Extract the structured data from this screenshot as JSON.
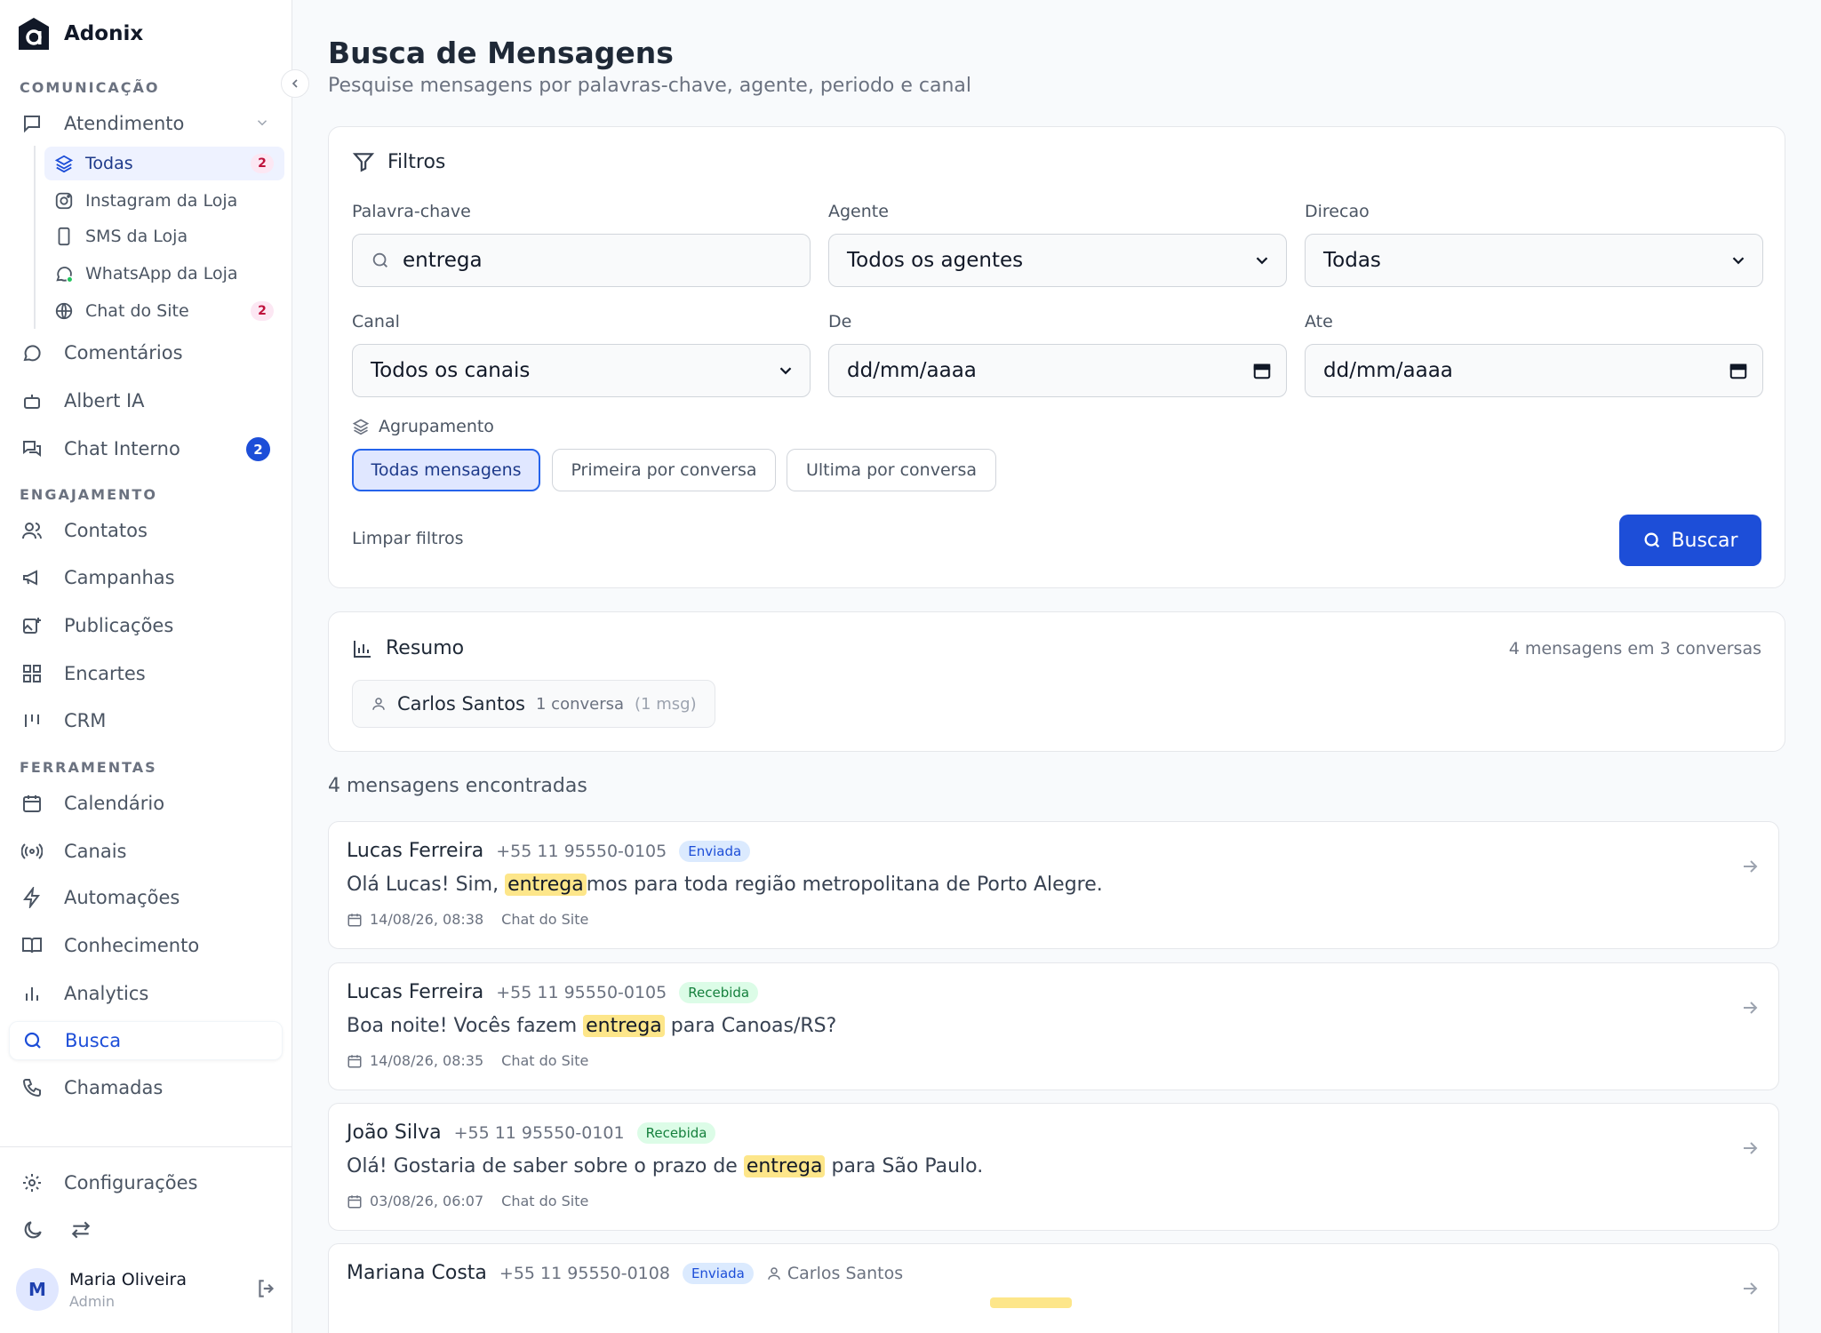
{
  "brand": {
    "name": "Adonix"
  },
  "sidebar": {
    "sections": {
      "comunicacao": "COMUNICAÇÃO",
      "engajamento": "ENGAJAMENTO",
      "ferramentas": "FERRAMENTAS"
    },
    "atendimento": {
      "label": "Atendimento",
      "children": [
        {
          "label": "Todas",
          "badge": "2"
        },
        {
          "label": "Instagram da Loja"
        },
        {
          "label": "SMS da Loja"
        },
        {
          "label": "WhatsApp da Loja"
        },
        {
          "label": "Chat do Site",
          "badge": "2"
        }
      ]
    },
    "comunicacao_items": [
      {
        "label": "Comentários"
      },
      {
        "label": "Albert IA"
      },
      {
        "label": "Chat Interno",
        "badge": "2"
      }
    ],
    "engajamento_items": [
      {
        "label": "Contatos"
      },
      {
        "label": "Campanhas"
      },
      {
        "label": "Publicações"
      },
      {
        "label": "Encartes"
      },
      {
        "label": "CRM"
      }
    ],
    "ferramentas_items": [
      {
        "label": "Calendário"
      },
      {
        "label": "Canais"
      },
      {
        "label": "Automações"
      },
      {
        "label": "Conhecimento"
      },
      {
        "label": "Analytics"
      },
      {
        "label": "Busca"
      },
      {
        "label": "Chamadas"
      }
    ],
    "settings_label": "Configurações",
    "user": {
      "initial": "M",
      "name": "Maria Oliveira",
      "role": "Admin"
    }
  },
  "page": {
    "title": "Busca de Mensagens",
    "subtitle": "Pesquise mensagens por palavras-chave, agente, periodo e canal"
  },
  "filters": {
    "title": "Filtros",
    "keyword": {
      "label": "Palavra-chave",
      "value": "entrega"
    },
    "agent": {
      "label": "Agente",
      "value": "Todos os agentes"
    },
    "direction": {
      "label": "Direcao",
      "value": "Todas"
    },
    "channel": {
      "label": "Canal",
      "value": "Todos os canais"
    },
    "from": {
      "label": "De",
      "value": "dd/mm/aaaa"
    },
    "to": {
      "label": "Ate",
      "value": "dd/mm/aaaa"
    },
    "grouping": {
      "label": "Agrupamento",
      "options": [
        "Todas mensagens",
        "Primeira por conversa",
        "Ultima por conversa"
      ],
      "selected": "Todas mensagens"
    },
    "clear_label": "Limpar filtros",
    "search_label": "Buscar"
  },
  "summary": {
    "title": "Resumo",
    "count": "4 mensagens em 3 conversas",
    "agents": [
      {
        "name": "Carlos Santos",
        "conversations": "1 conversa",
        "messages": "(1 msg)"
      }
    ]
  },
  "results": {
    "count_label": "4 mensagens encontradas",
    "items": [
      {
        "name": "Lucas Ferreira",
        "phone": "+55 11 95550-0105",
        "direction": "Enviada",
        "text_before": "Olá Lucas! Sim, ",
        "highlight": "entrega",
        "text_after": "mos para toda região metropolitana de Porto Alegre.",
        "date": "14/08/26, 08:38",
        "channel": "Chat do Site"
      },
      {
        "name": "Lucas Ferreira",
        "phone": "+55 11 95550-0105",
        "direction": "Recebida",
        "text_before": "Boa noite! Vocês fazem ",
        "highlight": "entrega",
        "text_after": " para Canoas/RS?",
        "date": "14/08/26, 08:35",
        "channel": "Chat do Site"
      },
      {
        "name": "João Silva",
        "phone": "+55 11 95550-0101",
        "direction": "Recebida",
        "text_before": "Olá! Gostaria de saber sobre o prazo de ",
        "highlight": "entrega",
        "text_after": " para São Paulo.",
        "date": "03/08/26, 06:07",
        "channel": "Chat do Site"
      },
      {
        "name": "Mariana Costa",
        "phone": "+55 11 95550-0108",
        "direction": "Enviada",
        "agent": "Carlos Santos"
      }
    ]
  },
  "colors": {
    "accent": "#1d4ed8",
    "highlight": "#fde68a",
    "sent_tag": "#dbeafe",
    "received_tag": "#dcfce7"
  }
}
